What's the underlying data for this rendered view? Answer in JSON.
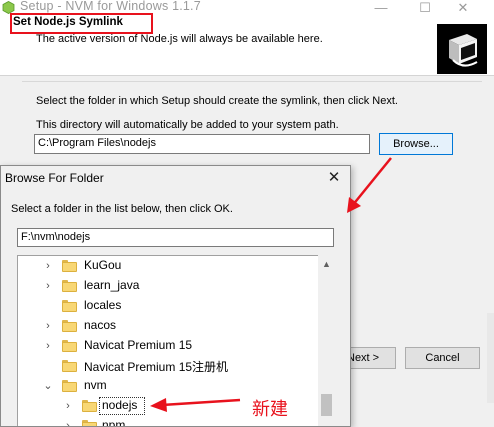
{
  "window": {
    "title": "Setup - NVM for Windows 1.1.7",
    "minimize_glyph": "—",
    "maximize_glyph": "☐",
    "close_glyph": "✕"
  },
  "header": {
    "title": "Set Node.js Symlink",
    "description": "The active version of Node.js will always be available here.",
    "logo_icon": "installer-box-icon"
  },
  "main": {
    "instruction": "Select the folder in which Setup should create the symlink, then click Next.",
    "path_note": "This directory will automatically be added to your system path.",
    "path_value": "C:\\Program Files\\nodejs",
    "browse_label": "Browse...",
    "next_label": "Next >",
    "cancel_label": "Cancel"
  },
  "dialog": {
    "title": "Browse For Folder",
    "close_glyph": "✕",
    "instruction": "Select a folder in the list below, then click OK.",
    "path_value": "F:\\nvm\\nodejs",
    "tree_items": [
      {
        "label": "KuGou",
        "expanded": false,
        "level": 1
      },
      {
        "label": "learn_java",
        "expanded": false,
        "level": 1
      },
      {
        "label": "locales",
        "expanded": null,
        "level": 1
      },
      {
        "label": "nacos",
        "expanded": false,
        "level": 1
      },
      {
        "label": "Navicat Premium 15",
        "expanded": false,
        "level": 1
      },
      {
        "label": "Navicat Premium 15注册机",
        "expanded": null,
        "level": 1
      },
      {
        "label": "nvm",
        "expanded": true,
        "level": 1
      },
      {
        "label": "nodejs",
        "expanded": false,
        "level": 2,
        "selected": true
      },
      {
        "label": "npm",
        "expanded": false,
        "level": 2
      }
    ]
  },
  "annotation": {
    "label": "新建",
    "color": "#e8121d"
  }
}
